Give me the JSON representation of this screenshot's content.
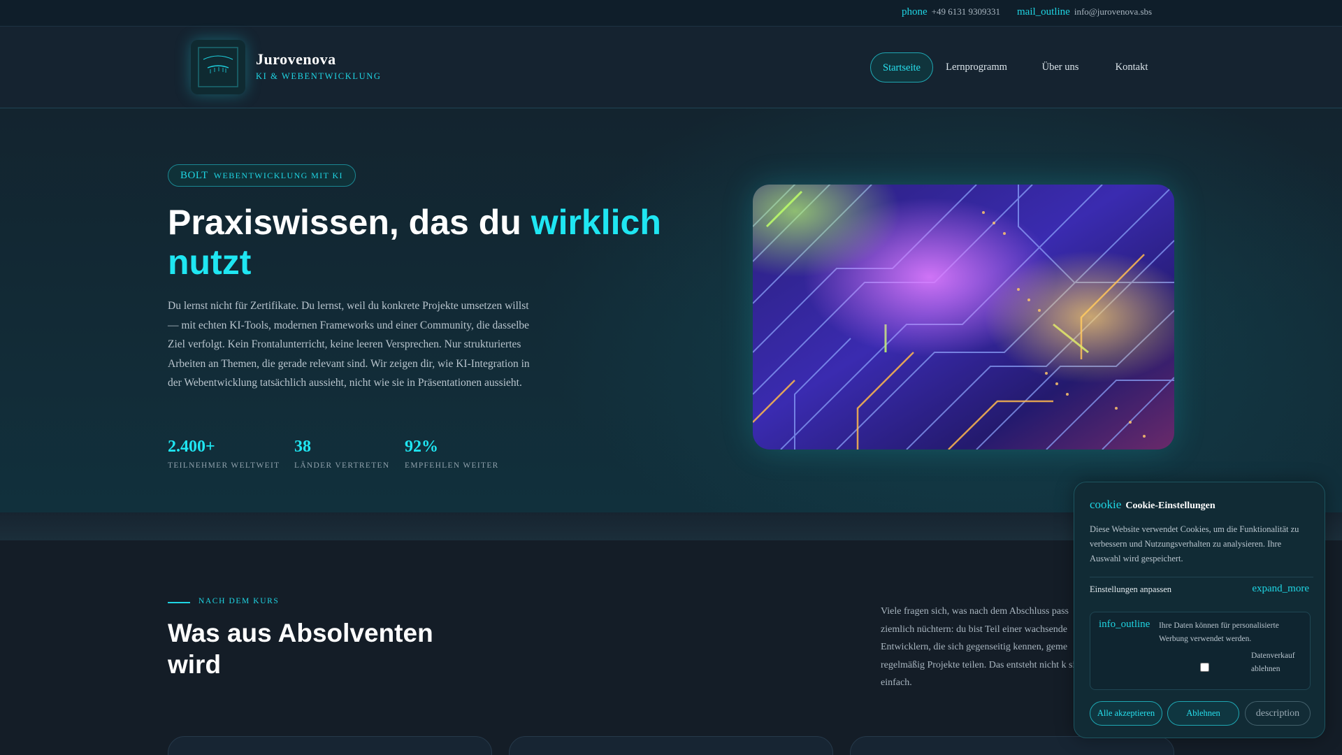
{
  "topbar": {
    "phone_icon": "phone",
    "phone": "+49 6131 9309331",
    "mail_icon": "mail_outline",
    "email": "info@jurovenova.sbs"
  },
  "header": {
    "brand_name": "Jurovenova",
    "brand_sub": "KI & WEBENTWICKLUNG",
    "nav": [
      {
        "label": "Startseite",
        "active": true
      },
      {
        "label": "Lernprogramm",
        "active": false
      },
      {
        "label": "Über uns",
        "active": false
      },
      {
        "label": "Kontakt",
        "active": false
      }
    ]
  },
  "hero": {
    "badge_icon": "BOLT",
    "badge_text": "WEBENTWICKLUNG MIT KI",
    "title_plain": "Praxiswissen, das du ",
    "title_accent": "wirklich nutzt",
    "text": "Du lernst nicht für Zertifikate. Du lernst, weil du konkrete Projekte umsetzen willst — mit echten KI-Tools, modernen Frameworks und einer Community, die dasselbe Ziel verfolgt. Kein Frontalunterricht, keine leeren Versprechen. Nur strukturiertes Arbeiten an Themen, die gerade relevant sind. Wir zeigen dir, wie KI-Integration in der Webentwicklung tatsächlich aussieht, nicht wie sie in Präsentationen aussieht.",
    "stats": [
      {
        "value": "2.400+",
        "label": "TEILNEHMER WELTWEIT"
      },
      {
        "value": "38",
        "label": "LÄNDER VERTRETEN"
      },
      {
        "value": "92%",
        "label": "EMPFEHLEN WEITER"
      }
    ]
  },
  "section": {
    "eyebrow": "NACH DEM KURS",
    "title": "Was aus Absolventen wird",
    "text": "Viele fragen sich, was nach dem Abschluss pass ziemlich nüchtern: du bist Teil einer wachsende Entwicklern, die sich gegenseitig kennen, geme regelmäßig Projekte teilen. Das entsteht nicht k sich einfach."
  },
  "cookie": {
    "icon": "cookie",
    "title": "Cookie-Einstellungen",
    "text": "Diese Website verwendet Cookies, um die Funktionalität zu verbessern und Nutzungsverhalten zu analysieren. Ihre Auswahl wird gespeichert.",
    "settings_label": "Einstellungen anpassen",
    "expand_icon": "expand_more",
    "info_icon": "info_outline",
    "info_text": "Ihre Daten können für personalisierte Werbung verwendet werden.",
    "checkbox_label": "Datenverkauf ablehnen",
    "checkbox_checked": false,
    "accept_label": "Alle akzeptieren",
    "reject_label": "Ablehnen",
    "details_label": "description"
  },
  "colors": {
    "accent": "#1fe6f2",
    "background": "#141d27"
  }
}
